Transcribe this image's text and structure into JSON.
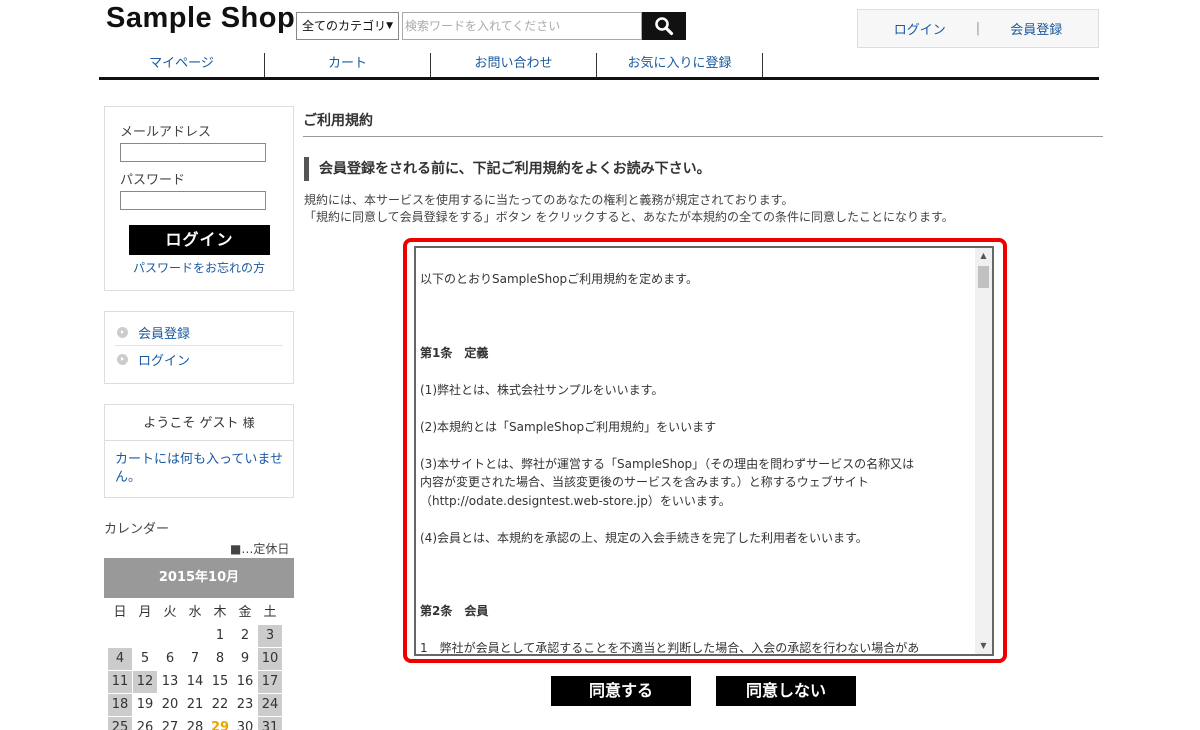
{
  "header": {
    "logo": "Sample Shop",
    "category_select": "全てのカテゴリ",
    "search_placeholder": "検索ワードを入れてください",
    "login": "ログイン",
    "register": "会員登録",
    "separator": "|"
  },
  "nav": [
    "マイページ",
    "カート",
    "お問い合わせ",
    "お気に入りに登録"
  ],
  "sidebar": {
    "email_label": "メールアドレス",
    "password_label": "パスワード",
    "login_button": "ログイン",
    "forgot_password": "パスワードをお忘れの方",
    "menu": [
      "会員登録",
      "ログイン"
    ],
    "welcome": "ようこそ ゲスト",
    "welcome_suffix": "様",
    "cart_message": "カートには何も入っていません。",
    "calendar_title": "カレンダー",
    "calendar_legend": "■…定休日",
    "calendar_month": "2015年10月",
    "weekdays": [
      "日",
      "月",
      "火",
      "水",
      "木",
      "金",
      "土"
    ],
    "days": [
      {
        "d": "",
        "hol": false
      },
      {
        "d": "",
        "hol": false
      },
      {
        "d": "",
        "hol": false
      },
      {
        "d": "",
        "hol": false
      },
      {
        "d": "1",
        "hol": false
      },
      {
        "d": "2",
        "hol": false
      },
      {
        "d": "3",
        "hol": true
      },
      {
        "d": "4",
        "hol": true
      },
      {
        "d": "5",
        "hol": false
      },
      {
        "d": "6",
        "hol": false
      },
      {
        "d": "7",
        "hol": false
      },
      {
        "d": "8",
        "hol": false
      },
      {
        "d": "9",
        "hol": false
      },
      {
        "d": "10",
        "hol": true
      },
      {
        "d": "11",
        "hol": true
      },
      {
        "d": "12",
        "hol": true
      },
      {
        "d": "13",
        "hol": false
      },
      {
        "d": "14",
        "hol": false
      },
      {
        "d": "15",
        "hol": false
      },
      {
        "d": "16",
        "hol": false
      },
      {
        "d": "17",
        "hol": true
      },
      {
        "d": "18",
        "hol": true
      },
      {
        "d": "19",
        "hol": false
      },
      {
        "d": "20",
        "hol": false
      },
      {
        "d": "21",
        "hol": false
      },
      {
        "d": "22",
        "hol": false
      },
      {
        "d": "23",
        "hol": false
      },
      {
        "d": "24",
        "hol": true
      },
      {
        "d": "25",
        "hol": true
      },
      {
        "d": "26",
        "hol": false
      },
      {
        "d": "27",
        "hol": false
      },
      {
        "d": "28",
        "hol": false
      },
      {
        "d": "29",
        "hol": false,
        "today": true
      },
      {
        "d": "30",
        "hol": false
      },
      {
        "d": "31",
        "hol": true
      }
    ]
  },
  "main": {
    "page_title": "ご利用規約",
    "sub_title": "会員登録をされる前に、下記ご利用規約をよくお読み下さい。",
    "intro_line1": "規約には、本サービスを使用するに当たってのあなたの権利と義務が規定されております。",
    "intro_line2": "「規約に同意して会員登録をする」ボタン をクリックすると、あなたが本規約の全ての条件に同意したことになります。",
    "terms": {
      "opening": "以下のとおりSampleShopご利用規約を定めます。",
      "article1_title": "第1条　定義",
      "item1": "(1)弊社とは、株式会社サンプルをいいます。",
      "item2": "(2)本規約とは「SampleShopご利用規約」をいいます",
      "item3_a": "(3)本サイトとは、弊社が運営する「SampleShop」（その理由を問わずサービスの名称又は",
      "item3_b": "内容が変更された場合、当該変更後のサービスを含みます。）と称するウェブサイト",
      "item3_c": "（http://odate.designtest.web-store.jp）をいいます。",
      "item4": "(4)会員とは、本規約を承認の上、規定の入会手続きを完了した利用者をいいます。",
      "article2_title": "第2条　会員",
      "article2_item1": "1　弊社が会員として承認することを不適当と判断した場合、入会の承認を行わない場合があ"
    },
    "agree_button": "同意する",
    "disagree_button": "同意しない"
  }
}
